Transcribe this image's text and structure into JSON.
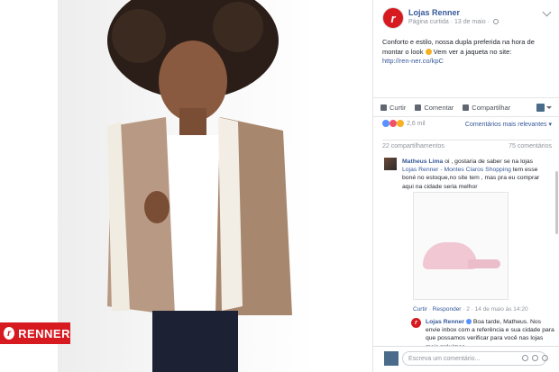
{
  "photo": {
    "brand_badge": "RENNER"
  },
  "post": {
    "page_name": "Lojas Renner",
    "meta": "Página curtida · 13 de maio ·",
    "text": "Conforto e estilo, nossa dupla preferida na hora de montar o look",
    "text2": "Vem ver a jaqueta no site:",
    "link": "http://ren-ner.co/kpC"
  },
  "actions": {
    "like": "Curtir",
    "comment": "Comentar",
    "share": "Compartilhar"
  },
  "reactions": {
    "count": "2,6 mil",
    "sort": "Comentários mais relevantes ▾"
  },
  "counts": {
    "shares": "22 compartilhamentos",
    "comments": "75 comentários"
  },
  "comment": {
    "author": "Matheus Lima",
    "text1": "oi , gostaria de saber se na lojas",
    "mention": "Lojas Renner - Montes Claros Shopping",
    "text2": "tem esse boné no estoque,no site tem , mas pra eu comprar aqui na cidade seria melhor",
    "footer_like": "Curtir",
    "footer_reply": "Responder",
    "footer_meta": "· 2 · 14 de maio às 14:20"
  },
  "reply": {
    "author": "Lojas Renner",
    "text": "Boa tarde, Matheus. Nos envie inbox com a referência e sua cidade para que possamos verificar para você nas lojas mais próximas."
  },
  "comment_box": {
    "placeholder": "Escreva um comentário..."
  }
}
